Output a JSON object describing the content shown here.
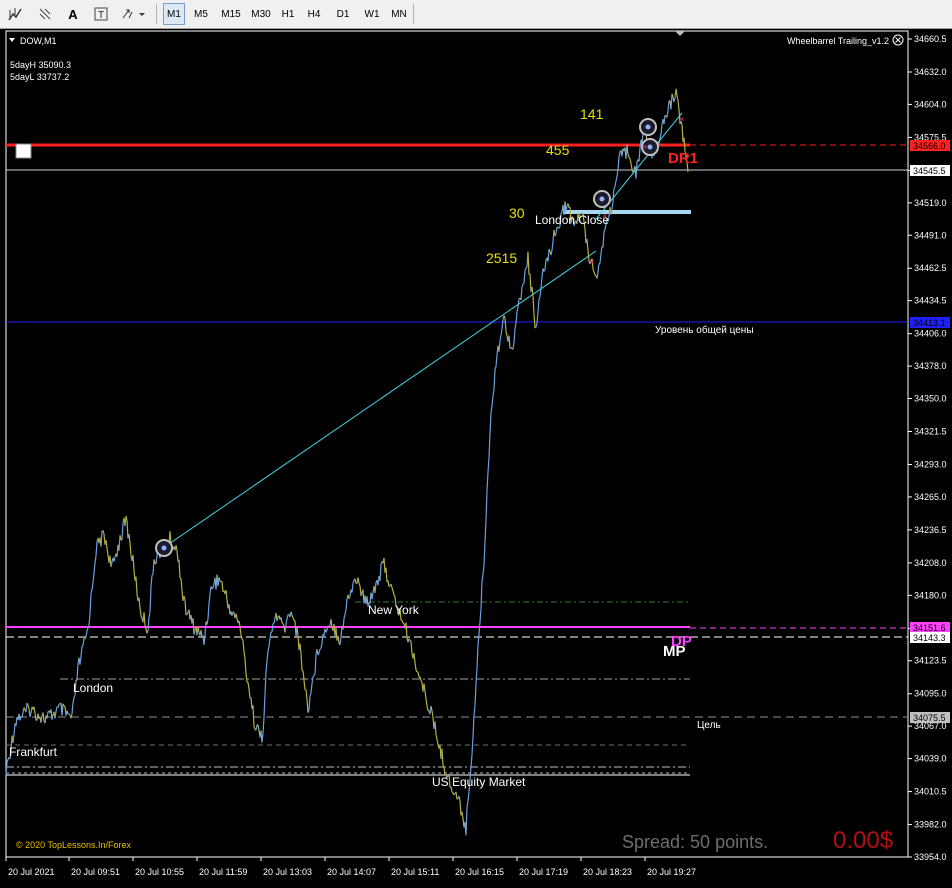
{
  "toolbar": {
    "timeframes": [
      "M1",
      "M5",
      "M15",
      "M30",
      "H1",
      "H4",
      "D1",
      "W1",
      "MN"
    ],
    "active_timeframe": "M1"
  },
  "chart": {
    "symbol_title": "DOW,M1",
    "indicator_name": "Wheelbarrel Trailing_v1.2",
    "info_high": "5dayH 35090.3",
    "info_low": "5dayL 33737.2",
    "copyright": "© 2020 TopLessons.In/Forex",
    "spread_text": "Spread: 50 points.",
    "profit_text": "0.00$",
    "colors": {
      "up": "#6aa0e0",
      "down": "#b8b040",
      "yellow_labels": "#e8e000",
      "red_line": "#ff2020",
      "pink_line": "#ff40ff",
      "blue_line": "#2020ff"
    }
  },
  "chart_data": {
    "type": "line",
    "y_axis": {
      "ticks": [
        "34660.5",
        "34632.0",
        "34604.0",
        "34575.5",
        "34547.0",
        "34519.0",
        "34491.0",
        "34462.5",
        "34434.5",
        "34406.0",
        "34378.0",
        "34350.0",
        "34321.5",
        "34293.0",
        "34265.0",
        "34236.5",
        "34208.0",
        "34180.0",
        "34151.5",
        "34123.5",
        "34095.0",
        "34067.0",
        "34039.0",
        "34010.5",
        "33982.0",
        "33954.0"
      ],
      "range": [
        33954.0,
        34660.5
      ]
    },
    "x_axis": {
      "ticks": [
        "20 Jul 2021",
        "20 Jul 09:51",
        "20 Jul 10:55",
        "20 Jul 11:59",
        "20 Jul 13:03",
        "20 Jul 14:07",
        "20 Jul 15:11",
        "20 Jul 16:15",
        "20 Jul 17:19",
        "20 Jul 18:23",
        "20 Jul 19:27"
      ]
    },
    "price_badges": [
      {
        "value": "34566.0",
        "kind": "red"
      },
      {
        "value": "34545.5",
        "kind": "white"
      },
      {
        "value": "34413.1",
        "kind": "blue"
      },
      {
        "value": "34151.6",
        "kind": "pink"
      },
      {
        "value": "34143.3",
        "kind": "white"
      },
      {
        "value": "34075.5",
        "kind": "gray"
      }
    ],
    "session_labels": [
      "London Close",
      "New York",
      "London",
      "Frankfurt",
      "US Equity Market"
    ],
    "level_labels": [
      "Уровень общей цены",
      "DR1",
      "DP",
      "MP",
      "Цель"
    ],
    "count_labels": [
      "141",
      "455",
      "30",
      "2515"
    ]
  }
}
